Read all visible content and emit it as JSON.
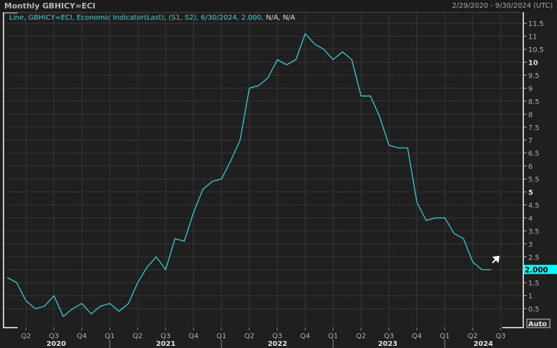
{
  "header": {
    "title": "Monthly GBHICY=ECI",
    "date_range": "2/29/2020 - 9/30/2024 (UTC)"
  },
  "legend": {
    "text": "Line, GBHICY=ECI, Economic Indicator(Last), (S1, S2), 6/30/2024, 2.000,",
    "na": "N/A, N/A"
  },
  "colors": {
    "line": "#2fe0e0",
    "background": "#1f1f1f",
    "grid": "#363636"
  },
  "auto_label": "Auto",
  "chart_data": {
    "type": "line",
    "title": "Monthly GBHICY=ECI",
    "series": [
      {
        "name": "GBHICY=ECI",
        "start": "2020-02",
        "values": [
          1.7,
          1.5,
          0.8,
          0.5,
          0.6,
          1.0,
          0.2,
          0.5,
          0.7,
          0.3,
          0.6,
          0.7,
          0.4,
          0.7,
          1.5,
          2.1,
          2.5,
          2.0,
          3.2,
          3.1,
          4.2,
          5.1,
          5.4,
          5.5,
          6.2,
          7.0,
          9.0,
          9.1,
          9.4,
          10.1,
          9.9,
          10.1,
          11.1,
          10.7,
          10.5,
          10.1,
          10.4,
          10.1,
          8.7,
          8.7,
          7.9,
          6.8,
          6.7,
          6.7,
          4.6,
          3.9,
          4.0,
          4.0,
          3.4,
          3.2,
          2.3,
          2.0,
          2.0
        ]
      }
    ],
    "last_value_label": "2.000",
    "ylim": [
      0,
      11.75
    ],
    "yticks": [
      "0.5",
      "1",
      "1.5",
      "2",
      "2.5",
      "3",
      "3.5",
      "4",
      "4.5",
      "5",
      "5.5",
      "6",
      "6.5",
      "7",
      "7.5",
      "8",
      "8.5",
      "9",
      "9.5",
      "10",
      "10.5",
      "11",
      "11.5"
    ],
    "xticks": [
      "Q2",
      "Q3",
      "Q4",
      "Q1",
      "Q2",
      "Q3",
      "Q4",
      "Q1",
      "Q2",
      "Q3",
      "Q4",
      "Q1",
      "Q2",
      "Q3",
      "Q4",
      "Q1",
      "Q2",
      "Q3"
    ],
    "years": [
      "2020",
      "2021",
      "2022",
      "2023",
      "2024"
    ],
    "grid": true
  }
}
